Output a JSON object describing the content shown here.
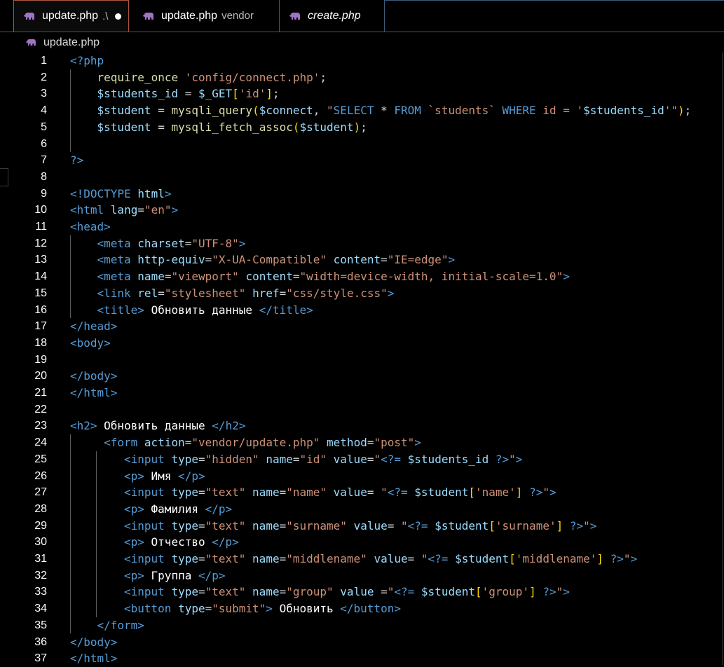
{
  "tabs": [
    {
      "label": "update.php",
      "sub": ".\\",
      "active": true,
      "modified": true,
      "italic": false
    },
    {
      "label": "update.php",
      "sub": "vendor",
      "active": false,
      "modified": false,
      "italic": false
    },
    {
      "label": "create.php",
      "sub": "",
      "active": false,
      "modified": false,
      "italic": true
    }
  ],
  "breadcrumb": {
    "file": "update.php",
    "icon": "php-elephant-icon"
  },
  "colors": {
    "tag": "#569cd6",
    "attr": "#9cdcfe",
    "string": "#ce9178",
    "func": "#dcdcaa",
    "variable": "#9cdcfe",
    "text": "#ffffff",
    "keyword": "#c586c0",
    "sqlkw": "#569cd6",
    "brace": "#ffd700",
    "bracket": "#da70d6",
    "default": "#d4d4d4",
    "icon": "#a074c4"
  },
  "lines": [
    {
      "n": "1",
      "indent": 0,
      "t": [
        [
          "<?php",
          "tag"
        ]
      ]
    },
    {
      "n": "2",
      "indent": 1,
      "t": [
        [
          "require_once ",
          "func"
        ],
        [
          "'config/connect.php'",
          "string"
        ],
        [
          ";",
          "default"
        ]
      ]
    },
    {
      "n": "3",
      "indent": 1,
      "t": [
        [
          "$students_id",
          "variable"
        ],
        [
          " = ",
          "default"
        ],
        [
          "$_GET",
          "variable"
        ],
        [
          "[",
          "brace"
        ],
        [
          "'id'",
          "string"
        ],
        [
          "]",
          "brace"
        ],
        [
          ";",
          "default"
        ]
      ]
    },
    {
      "n": "4",
      "indent": 1,
      "t": [
        [
          "$student",
          "variable"
        ],
        [
          " = ",
          "default"
        ],
        [
          "mysqli_query",
          "func"
        ],
        [
          "(",
          "brace"
        ],
        [
          "$connect",
          "variable"
        ],
        [
          ", ",
          "default"
        ],
        [
          "\"",
          "string"
        ],
        [
          "SELECT",
          "sqlkw"
        ],
        [
          " * ",
          "default"
        ],
        [
          "FROM",
          "sqlkw"
        ],
        [
          " `students` ",
          "string"
        ],
        [
          "WHERE",
          "sqlkw"
        ],
        [
          " id = '",
          "string"
        ],
        [
          "$students_id",
          "variable"
        ],
        [
          "'\"",
          "string"
        ],
        [
          ")",
          "brace"
        ],
        [
          ";",
          "default"
        ]
      ]
    },
    {
      "n": "5",
      "indent": 1,
      "t": [
        [
          "$student",
          "variable"
        ],
        [
          " = ",
          "default"
        ],
        [
          "mysqli_fetch_assoc",
          "func"
        ],
        [
          "(",
          "brace"
        ],
        [
          "$student",
          "variable"
        ],
        [
          ")",
          "brace"
        ],
        [
          ";",
          "default"
        ]
      ]
    },
    {
      "n": "6",
      "indent": 1,
      "t": []
    },
    {
      "n": "7",
      "indent": 0,
      "t": [
        [
          "?>",
          "tag"
        ]
      ]
    },
    {
      "n": "8",
      "indent": 0,
      "t": []
    },
    {
      "n": "9",
      "indent": 0,
      "t": [
        [
          "<!DOCTYPE ",
          "tag"
        ],
        [
          "html",
          "attr"
        ],
        [
          ">",
          "tag"
        ]
      ]
    },
    {
      "n": "10",
      "indent": 0,
      "t": [
        [
          "<html ",
          "tag"
        ],
        [
          "lang",
          "attr"
        ],
        [
          "=",
          "default"
        ],
        [
          "\"en\"",
          "string"
        ],
        [
          ">",
          "tag"
        ]
      ]
    },
    {
      "n": "11",
      "indent": 0,
      "t": [
        [
          "<head>",
          "tag"
        ]
      ]
    },
    {
      "n": "12",
      "indent": 1,
      "t": [
        [
          "<meta ",
          "tag"
        ],
        [
          "charset",
          "attr"
        ],
        [
          "=",
          "default"
        ],
        [
          "\"UTF-8\"",
          "string"
        ],
        [
          ">",
          "tag"
        ]
      ]
    },
    {
      "n": "13",
      "indent": 1,
      "t": [
        [
          "<meta ",
          "tag"
        ],
        [
          "http-equiv",
          "attr"
        ],
        [
          "=",
          "default"
        ],
        [
          "\"X-UA-Compatible\"",
          "string"
        ],
        [
          " ",
          "default"
        ],
        [
          "content",
          "attr"
        ],
        [
          "=",
          "default"
        ],
        [
          "\"IE=edge\"",
          "string"
        ],
        [
          ">",
          "tag"
        ]
      ]
    },
    {
      "n": "14",
      "indent": 1,
      "t": [
        [
          "<meta ",
          "tag"
        ],
        [
          "name",
          "attr"
        ],
        [
          "=",
          "default"
        ],
        [
          "\"viewport\"",
          "string"
        ],
        [
          " ",
          "default"
        ],
        [
          "content",
          "attr"
        ],
        [
          "=",
          "default"
        ],
        [
          "\"width=device-width, initial-scale=1.0\"",
          "string"
        ],
        [
          ">",
          "tag"
        ]
      ]
    },
    {
      "n": "15",
      "indent": 1,
      "t": [
        [
          "<link ",
          "tag"
        ],
        [
          "rel",
          "attr"
        ],
        [
          "=",
          "default"
        ],
        [
          "\"stylesheet\"",
          "string"
        ],
        [
          " ",
          "default"
        ],
        [
          "href",
          "attr"
        ],
        [
          "=",
          "default"
        ],
        [
          "\"css/style.css\"",
          "string"
        ],
        [
          ">",
          "tag"
        ]
      ]
    },
    {
      "n": "16",
      "indent": 1,
      "t": [
        [
          "<title>",
          "tag"
        ],
        [
          " Обновить данные ",
          "text"
        ],
        [
          "</title>",
          "tag"
        ]
      ]
    },
    {
      "n": "17",
      "indent": 0,
      "t": [
        [
          "</head>",
          "tag"
        ]
      ]
    },
    {
      "n": "18",
      "indent": 0,
      "t": [
        [
          "<body>",
          "tag"
        ]
      ]
    },
    {
      "n": "19",
      "indent": 0,
      "t": []
    },
    {
      "n": "20",
      "indent": 0,
      "t": [
        [
          "</body>",
          "tag"
        ]
      ]
    },
    {
      "n": "21",
      "indent": 0,
      "t": [
        [
          "</html>",
          "tag"
        ]
      ]
    },
    {
      "n": "22",
      "indent": 0,
      "t": []
    },
    {
      "n": "23",
      "indent": 0,
      "t": [
        [
          "<h2>",
          "tag"
        ],
        [
          " Обновить данные ",
          "text"
        ],
        [
          "</h2>",
          "tag"
        ]
      ]
    },
    {
      "n": "24",
      "indent": 1.25,
      "t": [
        [
          "<form ",
          "tag"
        ],
        [
          "action",
          "attr"
        ],
        [
          "=",
          "default"
        ],
        [
          "\"vendor/update.php\"",
          "string"
        ],
        [
          " ",
          "default"
        ],
        [
          "method",
          "attr"
        ],
        [
          "=",
          "default"
        ],
        [
          "\"post\"",
          "string"
        ],
        [
          ">",
          "tag"
        ]
      ]
    },
    {
      "n": "25",
      "indent": 2,
      "t": [
        [
          "<input ",
          "tag"
        ],
        [
          "type",
          "attr"
        ],
        [
          "=",
          "default"
        ],
        [
          "\"hidden\"",
          "string"
        ],
        [
          " ",
          "default"
        ],
        [
          "name",
          "attr"
        ],
        [
          "=",
          "default"
        ],
        [
          "\"id\"",
          "string"
        ],
        [
          " ",
          "default"
        ],
        [
          "value",
          "attr"
        ],
        [
          "=",
          "default"
        ],
        [
          "\"",
          "string"
        ],
        [
          "<?=",
          "tag"
        ],
        [
          " ",
          "default"
        ],
        [
          "$students_id",
          "variable"
        ],
        [
          " ",
          "default"
        ],
        [
          "?>",
          "tag"
        ],
        [
          "\"",
          "string"
        ],
        [
          ">",
          "tag"
        ]
      ]
    },
    {
      "n": "26",
      "indent": 2,
      "t": [
        [
          "<p>",
          "tag"
        ],
        [
          " Имя ",
          "text"
        ],
        [
          "</p>",
          "tag"
        ]
      ]
    },
    {
      "n": "27",
      "indent": 2,
      "t": [
        [
          "<input ",
          "tag"
        ],
        [
          "type",
          "attr"
        ],
        [
          "=",
          "default"
        ],
        [
          "\"text\"",
          "string"
        ],
        [
          " ",
          "default"
        ],
        [
          "name",
          "attr"
        ],
        [
          "=",
          "default"
        ],
        [
          "\"name\"",
          "string"
        ],
        [
          " ",
          "default"
        ],
        [
          "value",
          "attr"
        ],
        [
          "= ",
          "default"
        ],
        [
          "\"",
          "string"
        ],
        [
          "<?=",
          "tag"
        ],
        [
          " ",
          "default"
        ],
        [
          "$student",
          "variable"
        ],
        [
          "[",
          "brace"
        ],
        [
          "'name'",
          "string"
        ],
        [
          "]",
          "brace"
        ],
        [
          " ",
          "default"
        ],
        [
          "?>",
          "tag"
        ],
        [
          "\"",
          "string"
        ],
        [
          ">",
          "tag"
        ]
      ]
    },
    {
      "n": "28",
      "indent": 2,
      "t": [
        [
          "<p>",
          "tag"
        ],
        [
          " Фамилия ",
          "text"
        ],
        [
          "</p>",
          "tag"
        ]
      ]
    },
    {
      "n": "29",
      "indent": 2,
      "t": [
        [
          "<input ",
          "tag"
        ],
        [
          "type",
          "attr"
        ],
        [
          "=",
          "default"
        ],
        [
          "\"text\"",
          "string"
        ],
        [
          " ",
          "default"
        ],
        [
          "name",
          "attr"
        ],
        [
          "=",
          "default"
        ],
        [
          "\"surname\"",
          "string"
        ],
        [
          " ",
          "default"
        ],
        [
          "value",
          "attr"
        ],
        [
          "= ",
          "default"
        ],
        [
          "\"",
          "string"
        ],
        [
          "<?=",
          "tag"
        ],
        [
          " ",
          "default"
        ],
        [
          "$student",
          "variable"
        ],
        [
          "[",
          "brace"
        ],
        [
          "'surname'",
          "string"
        ],
        [
          "]",
          "brace"
        ],
        [
          " ",
          "default"
        ],
        [
          "?>",
          "tag"
        ],
        [
          "\"",
          "string"
        ],
        [
          ">",
          "tag"
        ]
      ]
    },
    {
      "n": "30",
      "indent": 2,
      "t": [
        [
          "<p>",
          "tag"
        ],
        [
          " Отчество ",
          "text"
        ],
        [
          "</p>",
          "tag"
        ]
      ]
    },
    {
      "n": "31",
      "indent": 2,
      "t": [
        [
          "<input ",
          "tag"
        ],
        [
          "type",
          "attr"
        ],
        [
          "=",
          "default"
        ],
        [
          "\"text\"",
          "string"
        ],
        [
          " ",
          "default"
        ],
        [
          "name",
          "attr"
        ],
        [
          "=",
          "default"
        ],
        [
          "\"middlename\"",
          "string"
        ],
        [
          " ",
          "default"
        ],
        [
          "value",
          "attr"
        ],
        [
          "= ",
          "default"
        ],
        [
          "\"",
          "string"
        ],
        [
          "<?=",
          "tag"
        ],
        [
          " ",
          "default"
        ],
        [
          "$student",
          "variable"
        ],
        [
          "[",
          "brace"
        ],
        [
          "'middlename'",
          "string"
        ],
        [
          "]",
          "brace"
        ],
        [
          " ",
          "default"
        ],
        [
          "?>",
          "tag"
        ],
        [
          "\"",
          "string"
        ],
        [
          ">",
          "tag"
        ]
      ]
    },
    {
      "n": "32",
      "indent": 2,
      "t": [
        [
          "<p>",
          "tag"
        ],
        [
          " Группа ",
          "text"
        ],
        [
          "</p>",
          "tag"
        ]
      ]
    },
    {
      "n": "33",
      "indent": 2,
      "t": [
        [
          "<input ",
          "tag"
        ],
        [
          "type",
          "attr"
        ],
        [
          "=",
          "default"
        ],
        [
          "\"text\"",
          "string"
        ],
        [
          " ",
          "default"
        ],
        [
          "name",
          "attr"
        ],
        [
          "=",
          "default"
        ],
        [
          "\"group\"",
          "string"
        ],
        [
          " ",
          "default"
        ],
        [
          "value",
          "attr"
        ],
        [
          " =",
          "default"
        ],
        [
          "\"",
          "string"
        ],
        [
          "<?=",
          "tag"
        ],
        [
          " ",
          "default"
        ],
        [
          "$student",
          "variable"
        ],
        [
          "[",
          "brace"
        ],
        [
          "'group'",
          "string"
        ],
        [
          "]",
          "brace"
        ],
        [
          " ",
          "default"
        ],
        [
          "?>",
          "tag"
        ],
        [
          "\"",
          "string"
        ],
        [
          ">",
          "tag"
        ]
      ]
    },
    {
      "n": "34",
      "indent": 2,
      "t": [
        [
          "<button ",
          "tag"
        ],
        [
          "type",
          "attr"
        ],
        [
          "=",
          "default"
        ],
        [
          "\"submit\"",
          "string"
        ],
        [
          ">",
          "tag"
        ],
        [
          " Обновить ",
          "text"
        ],
        [
          "</button>",
          "tag"
        ]
      ]
    },
    {
      "n": "35",
      "indent": 1,
      "t": [
        [
          "</form>",
          "tag"
        ]
      ]
    },
    {
      "n": "36",
      "indent": 0,
      "t": [
        [
          "</body>",
          "tag"
        ]
      ]
    },
    {
      "n": "37",
      "indent": 0,
      "t": [
        [
          "</html>",
          "tag"
        ]
      ]
    }
  ]
}
